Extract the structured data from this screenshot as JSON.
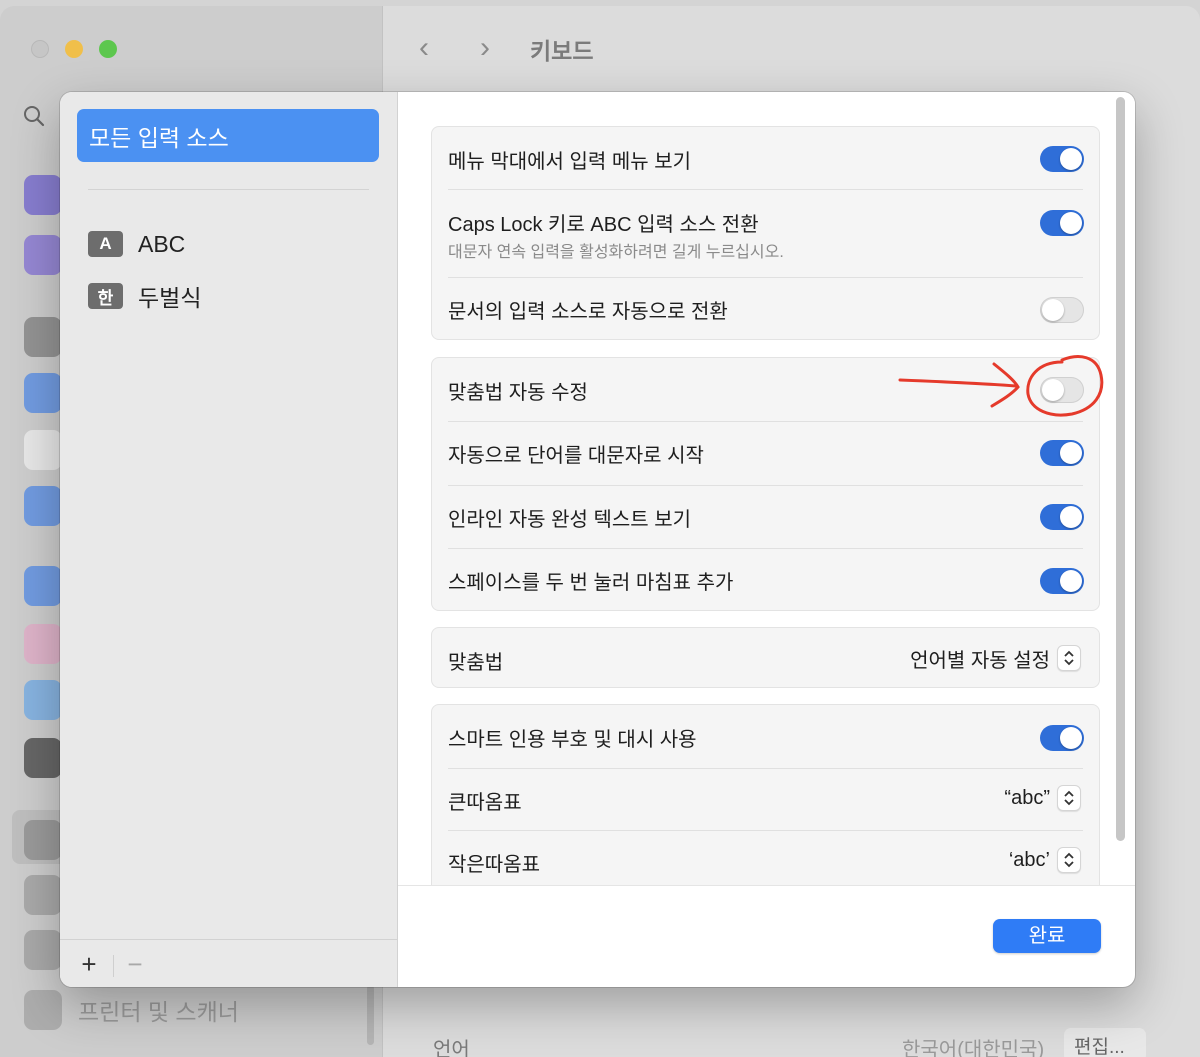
{
  "window": {
    "title": "키보드",
    "background_printer_label": "프린터 및 스캐너",
    "background_language_label": "언어",
    "background_language_value": "한국어(대한민국)",
    "background_edit_label": "편집..."
  },
  "sidebar": {
    "selected": "모든 입력 소스",
    "sources": [
      {
        "badge": "A",
        "label": "ABC"
      },
      {
        "badge": "한",
        "label": "두벌식"
      }
    ],
    "add_label": "+",
    "remove_label": "−"
  },
  "groups": {
    "general": [
      {
        "label": "메뉴 막대에서 입력 메뉴 보기",
        "enabled": true
      },
      {
        "label": "Caps Lock 키로 ABC 입력 소스 전환",
        "sublabel": "대문자 연속 입력을 활성화하려면 길게 누르십시오.",
        "enabled": true
      },
      {
        "label": "문서의 입력 소스로 자동으로 전환",
        "enabled": false
      }
    ],
    "text": [
      {
        "label": "맞춤법 자동 수정",
        "enabled": false
      },
      {
        "label": "자동으로 단어를 대문자로 시작",
        "enabled": true
      },
      {
        "label": "인라인 자동 완성 텍스트 보기",
        "enabled": true
      },
      {
        "label": "스페이스를 두 번 눌러 마침표 추가",
        "enabled": true
      }
    ],
    "spelling": {
      "label": "맞춤법",
      "value": "언어별 자동 설정"
    },
    "quotes": [
      {
        "label": "스마트 인용 부호 및 대시 사용",
        "enabled": true
      },
      {
        "label": "큰따옴표",
        "value": "“abc”"
      },
      {
        "label": "작은따옴표",
        "value": "‘abc’"
      }
    ]
  },
  "footer": {
    "done_label": "완료"
  },
  "colors": {
    "accent": "#2f6ed8",
    "selection": "#4b91f2",
    "annotation": "#e53a2b"
  }
}
